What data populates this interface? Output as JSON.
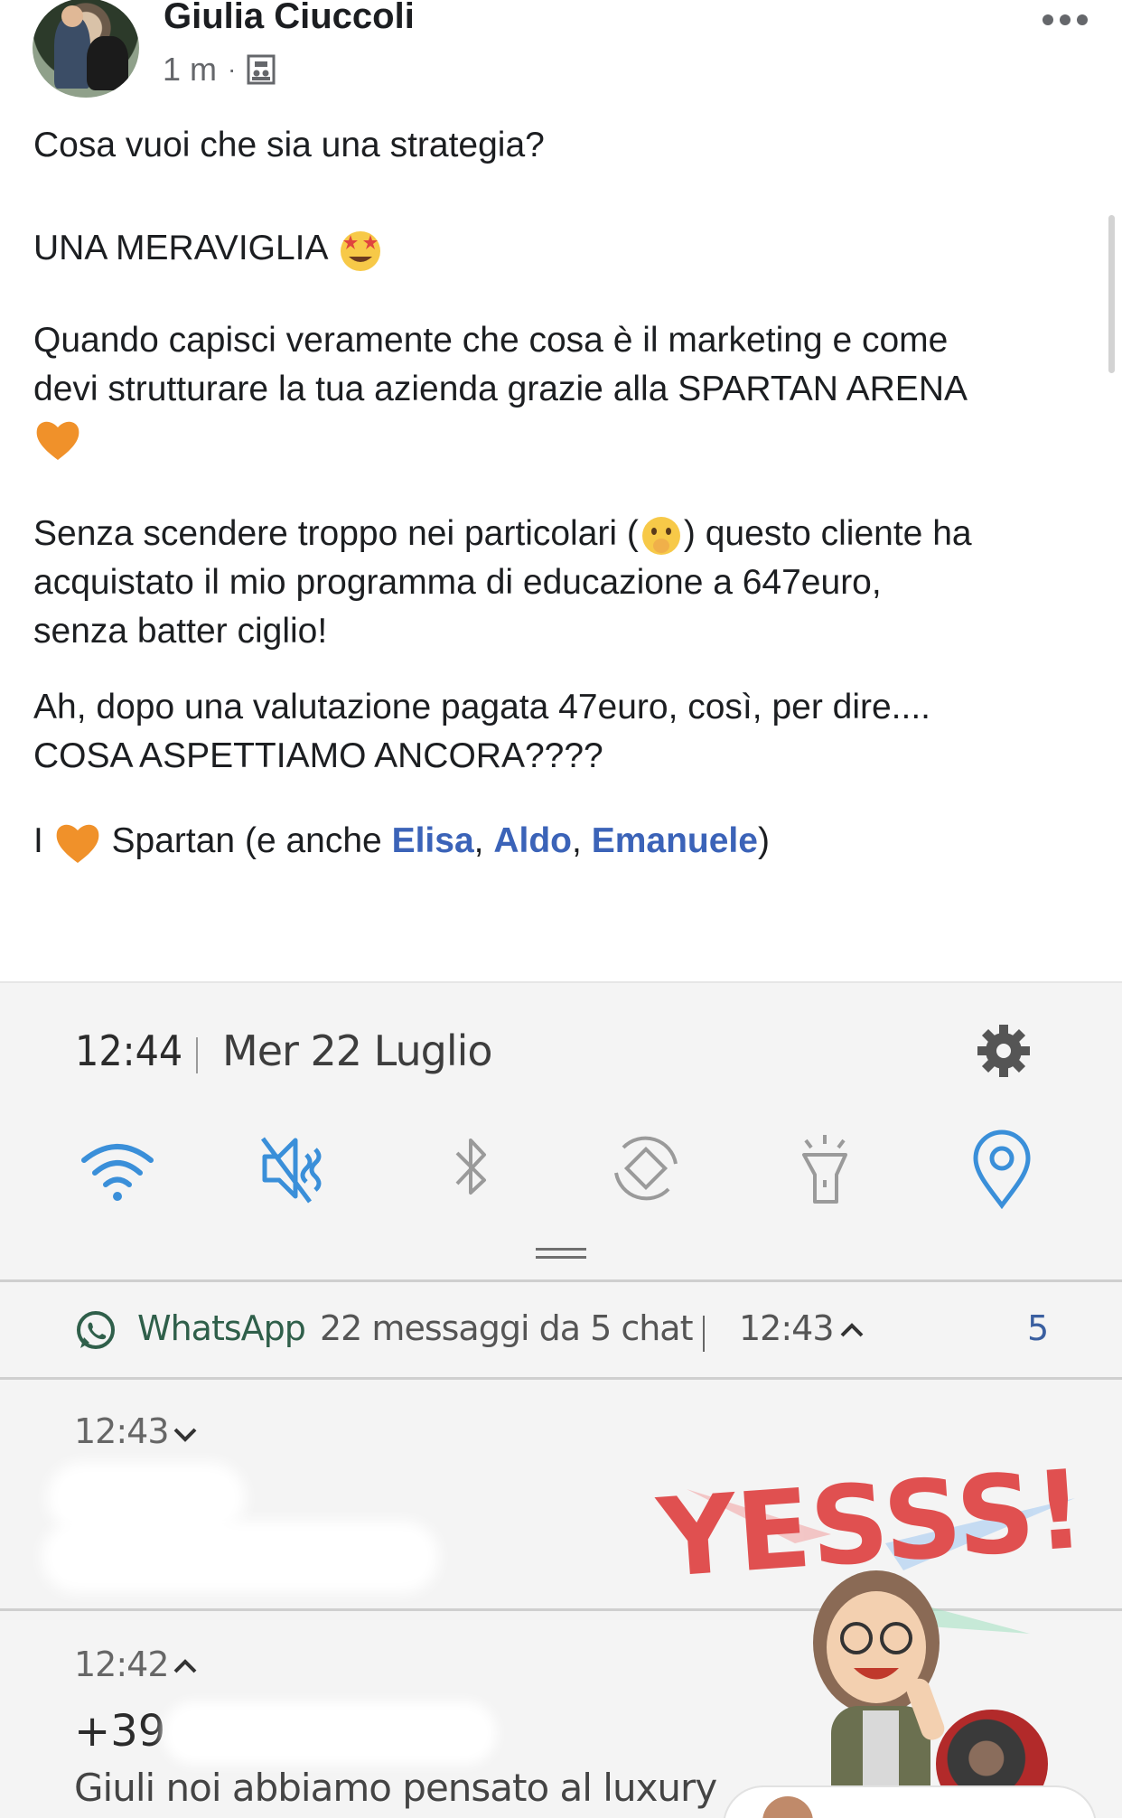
{
  "post": {
    "author": "Giulia Ciuccoli",
    "time": "1 m",
    "meta_separator": "·",
    "audience_icon": "friends-audience-icon",
    "more_icon": "more-options-icon",
    "lines": {
      "l1": "Cosa vuoi che sia una strategia?",
      "l2": "UNA MERAVIGLIA",
      "l3a": "Quando capisci veramente che cosa è il marketing e come",
      "l3b": "devi strutturare la tua azienda grazie alla SPARTAN ARENA",
      "l4a_pre": "Senza scendere troppo nei particolari (",
      "l4a_post": ") questo cliente ha",
      "l4b": "acquistato il mio programma di educazione a 647euro,",
      "l4c": "senza batter ciglio!",
      "l5a": "Ah, dopo una valutazione pagata 47euro, così, per dire....",
      "l5b": "COSA ASPETTIAMO ANCORA????",
      "l6_pre": "I",
      "l6_mid": "Spartan (e anche",
      "m1": "Elisa",
      "comma": ",",
      "m2": "Aldo",
      "m3": "Emanuele",
      "l6_end": ")"
    },
    "emojis": [
      "star-struck-emoji",
      "orange-heart-emoji",
      "shushing-face-emoji",
      "orange-heart-emoji"
    ]
  },
  "screenshot": {
    "clock": "12:44",
    "date": "Mer 22 Luglio",
    "quick_settings": [
      "wifi-icon",
      "mute-icon",
      "bluetooth-icon",
      "auto-rotate-icon",
      "flashlight-icon",
      "location-icon"
    ],
    "whatsapp": {
      "app": "WhatsApp",
      "summary": "22 messaggi da 5 chat",
      "separator": "|",
      "time": "12:43",
      "count": "5"
    },
    "notif1": {
      "time": "12:43"
    },
    "notif2": {
      "time": "12:42",
      "phone": "+39",
      "message": "Giuli noi abbiamo pensato al luxury"
    },
    "sticker_text": "YESSS!"
  },
  "colors": {
    "mention": "#3b63b8",
    "accent_blue": "#3a8fd9",
    "whatsapp_green": "#2f5f4a"
  }
}
